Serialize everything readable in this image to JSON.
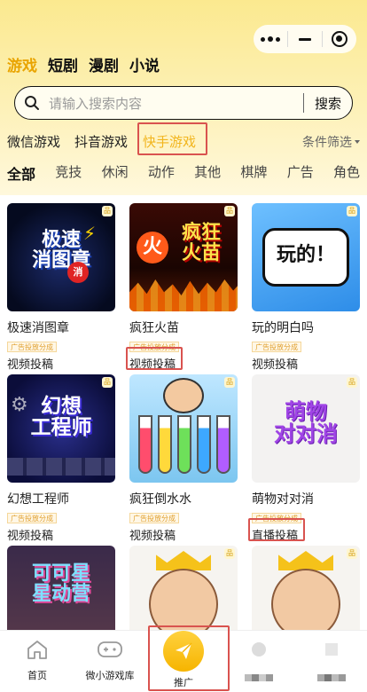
{
  "top_tabs": [
    "游戏",
    "短剧",
    "漫剧",
    "小说"
  ],
  "search": {
    "placeholder": "请输入搜索内容",
    "button": "搜索"
  },
  "platforms": [
    "微信游戏",
    "抖音游戏",
    "快手游戏"
  ],
  "filter_label": "条件筛选",
  "categories": [
    "全部",
    "竞技",
    "休闲",
    "动作",
    "其他",
    "棋牌",
    "广告",
    "角色"
  ],
  "corner_badge": "品",
  "thumb_titles": {
    "g1": [
      "极速",
      "消图章"
    ],
    "g1_badge": "消",
    "g2": [
      "疯狂",
      "火苗"
    ],
    "g2_fire": "火",
    "g3": "玩的！",
    "g4": [
      "幻想",
      "工程师"
    ],
    "g6": [
      "萌物",
      "对对消"
    ],
    "g7": [
      "可可星",
      "星动营"
    ]
  },
  "games": [
    {
      "name": "极速消图章",
      "tag": "广告投放分成",
      "submit": "视频投稿"
    },
    {
      "name": "疯狂火苗",
      "tag": "广告投放分成",
      "submit": "视频投稿"
    },
    {
      "name": "玩的明白吗",
      "tag": "广告投放分成",
      "submit": "视频投稿"
    },
    {
      "name": "幻想工程师",
      "tag": "广告投放分成",
      "submit": "视频投稿"
    },
    {
      "name": "疯狂倒水水",
      "tag": "广告投放分成",
      "submit": "视频投稿"
    },
    {
      "name": "萌物对对消",
      "tag": "广告投放分成",
      "submit": "直播投稿"
    }
  ],
  "bottom_nav": [
    "首页",
    "微小游戏库",
    "推广"
  ],
  "colors": {
    "accent": "#f2b51d",
    "highlight_box": "#d9534f",
    "header": "#fbe98f"
  }
}
